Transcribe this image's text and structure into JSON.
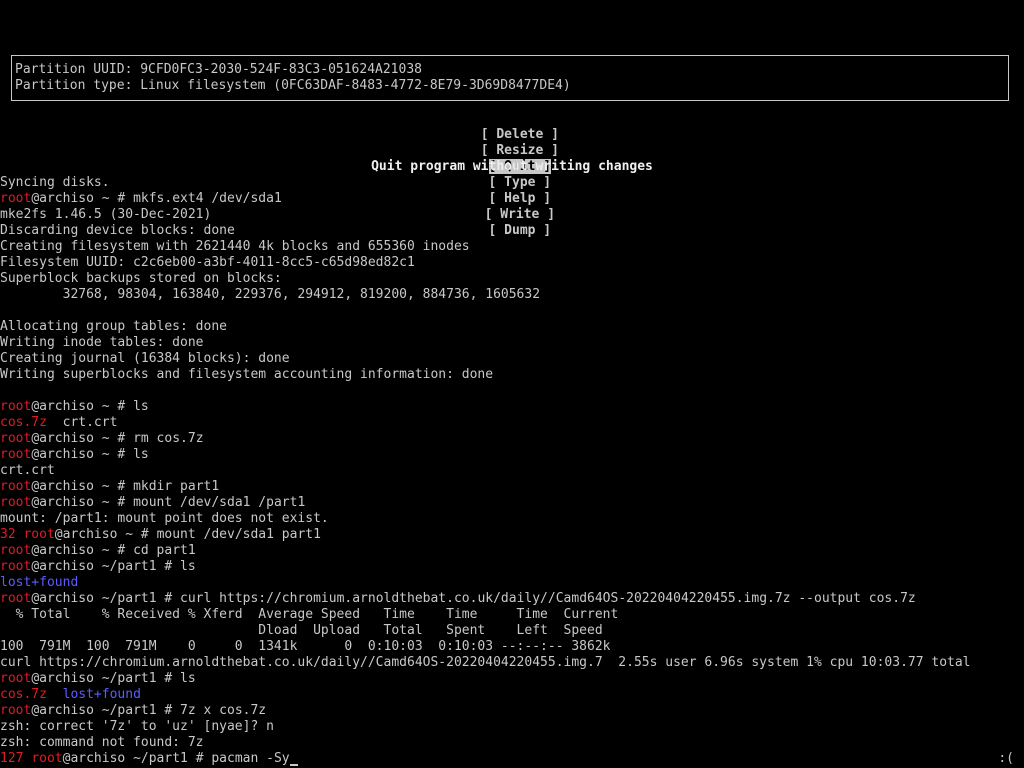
{
  "cfdisk": {
    "partition_uuid": "Partition UUID: 9CFD0FC3-2030-524F-83C3-051624A21038",
    "partition_type": "Partition type: Linux filesystem (0FC63DAF-8483-4772-8E79-3D69D8477DE4)",
    "menu": {
      "delete": "[ Delete ]",
      "resize": "[ Resize ]",
      "quit_open": "[ ",
      "quit": "Quit",
      "quit_close": " ]",
      "type": "[ Type ]",
      "help": "[ Help ]",
      "write": "[ Write ]",
      "dump": "[ Dump ]"
    },
    "help_text": "Quit program without writing changes"
  },
  "terminal": {
    "prompt_user": "root",
    "prompt_host": "@archiso",
    "prompt_home": " ~ # ",
    "prompt_part1": " ~/part1 # ",
    "lines": {
      "l01": "Syncing disks.",
      "c02": "mkfs.ext4 /dev/sda1",
      "l03": "mke2fs 1.46.5 (30-Dec-2021)",
      "l04": "Discarding device blocks: done",
      "l05": "Creating filesystem with 2621440 4k blocks and 655360 inodes",
      "l06": "Filesystem UUID: c2c6eb00-a3bf-4011-8cc5-c65d98ed82c1",
      "l07": "Superblock backups stored on blocks:",
      "l08": "        32768, 98304, 163840, 229376, 294912, 819200, 884736, 1605632",
      "l09": "",
      "l10": "Allocating group tables: done",
      "l11": "Writing inode tables: done",
      "l12": "Creating journal (16384 blocks): done",
      "l13": "Writing superblocks and filesystem accounting information: done",
      "l14": "",
      "c15": "ls",
      "l16a": "cos.7z",
      "l16b": "  crt.crt",
      "c17": "rm cos.7z",
      "c18": "ls",
      "l19": "crt.crt",
      "c20": "mkdir part1",
      "c21": "mount /dev/sda1 /part1",
      "l22": "mount: /part1: mount point does not exist.",
      "s23": "32 ",
      "c23": "mount /dev/sda1 part1",
      "c24": "cd part1",
      "c25": "ls",
      "l26": "lost+found",
      "c27": "curl https://chromium.arnoldthebat.co.uk/daily//Camd64OS-20220404220455.img.7z --output cos.7z",
      "l28": "  % Total    % Received % Xferd  Average Speed   Time    Time     Time  Current",
      "l29": "                                 Dload  Upload   Total   Spent    Left  Speed",
      "l30": "100  791M  100  791M    0     0  1341k      0  0:10:03  0:10:03 --:--:-- 3862k",
      "l31": "curl https://chromium.arnoldthebat.co.uk/daily//Camd64OS-20220404220455.img.7  2.55s user 6.96s system 1% cpu 10:03.77 total",
      "c32": "ls",
      "l33a": "cos.7z",
      "l33b": "lost+found",
      "c34": "7z x cos.7z",
      "l35": "zsh: correct '7z' to 'uz' [nyae]? n",
      "l36": "zsh: command not found: 7z",
      "s37": "127 ",
      "c37": "pacman -Sy"
    },
    "status_right": ":("
  }
}
